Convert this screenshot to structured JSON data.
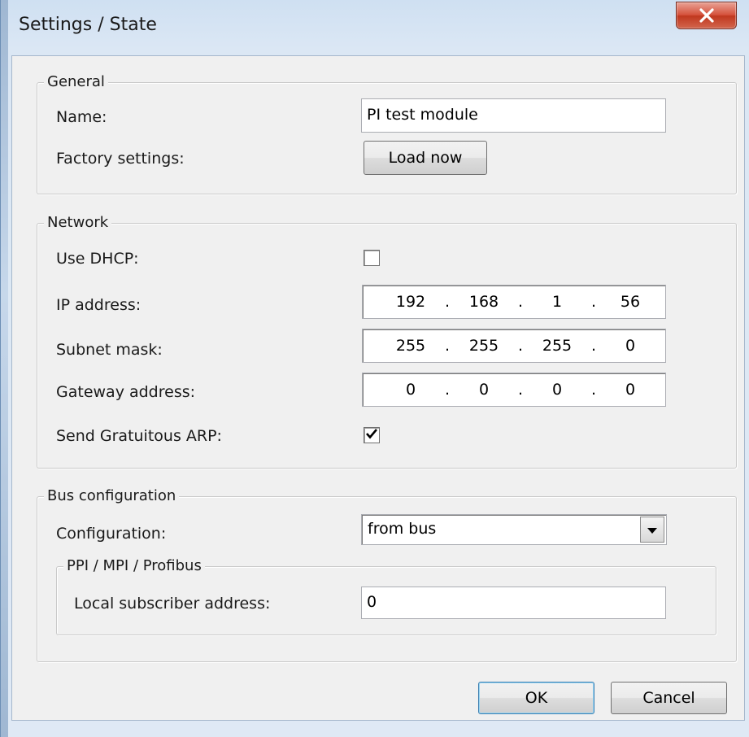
{
  "window": {
    "title": "Settings / State",
    "close_icon": "close-x-icon"
  },
  "general": {
    "legend": "General",
    "name_label": "Name:",
    "name_value": "PI test module",
    "factory_label": "Factory settings:",
    "load_button": "Load now"
  },
  "network": {
    "legend": "Network",
    "dhcp_label": "Use DHCP:",
    "dhcp_checked": false,
    "ip_label": "IP address:",
    "ip": [
      "192",
      "168",
      "1",
      "56"
    ],
    "subnet_label": "Subnet mask:",
    "subnet": [
      "255",
      "255",
      "255",
      "0"
    ],
    "gateway_label": "Gateway address:",
    "gateway": [
      "0",
      "0",
      "0",
      "0"
    ],
    "arp_label": "Send Gratuitous ARP:",
    "arp_checked": true,
    "separator": "."
  },
  "bus": {
    "legend": "Bus configuration",
    "config_label": "Configuration:",
    "config_value": "from bus",
    "ppi": {
      "legend": "PPI / MPI / Profibus",
      "subscriber_label": "Local subscriber address:",
      "subscriber_value": "0"
    }
  },
  "footer": {
    "ok": "OK",
    "cancel": "Cancel"
  }
}
